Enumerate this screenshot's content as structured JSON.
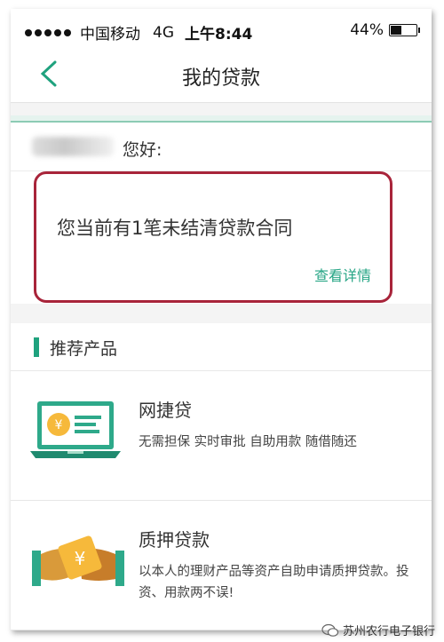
{
  "status_bar": {
    "carrier": "中国移动",
    "network": "4G",
    "time": "上午8:44",
    "battery": "44%"
  },
  "nav": {
    "title": "我的贷款",
    "back_icon": "chevron-left-icon"
  },
  "greeting": {
    "text": "您好:"
  },
  "loan_summary": {
    "message": "您当前有1笔未结清贷款合同",
    "detail_link": "查看详情"
  },
  "recommended": {
    "section_title": "推荐产品",
    "products": [
      {
        "name": "网捷贷",
        "description": "无需担保 实时审批 自助用款 随借随还",
        "icon": "laptop-coin-icon"
      },
      {
        "name": "质押贷款",
        "description": "以本人的理财产品等资产自助申请质押贷款。投资、用款两不误!",
        "icon": "handshake-coin-icon"
      }
    ]
  },
  "watermark": {
    "text": "苏州农行电子银行"
  },
  "colors": {
    "accent_green": "#1fa27e",
    "highlight_red": "#a8243a",
    "link_green": "#26a585"
  }
}
